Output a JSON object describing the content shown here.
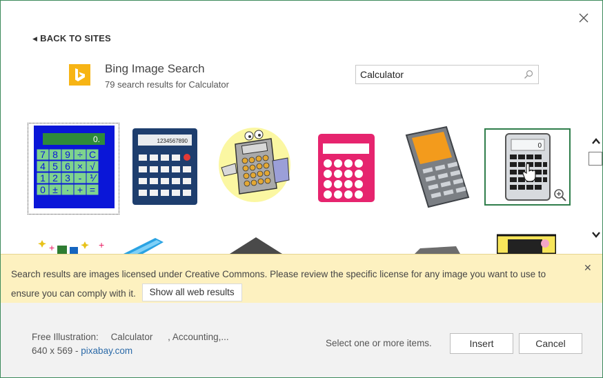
{
  "dialog": {
    "close_label": "Close",
    "back_link": "BACK TO SITES",
    "source": {
      "name": "Bing Image Search",
      "results": "79 search results for Calculator"
    },
    "search": {
      "value": "Calculator",
      "placeholder": ""
    },
    "thumbnails": [
      {
        "name": "calculator-blue-green-keys",
        "state": "focused"
      },
      {
        "name": "calculator-navy-1234567890",
        "display_text": "1234567890"
      },
      {
        "name": "calculator-cartoon-character"
      },
      {
        "name": "calculator-pink"
      },
      {
        "name": "calculator-gray-orange-screen"
      },
      {
        "name": "calculator-gray-pointer",
        "state": "selected"
      }
    ],
    "notice": {
      "text": "Search results are images licensed under Creative Commons. Please review the specific license for any image you want to use to ensure you can comply with it.",
      "button": "Show all web results",
      "close": "✕"
    },
    "footer": {
      "caption_label": "Free Illustration:",
      "caption_term": "Calculator",
      "caption_more": ", Accounting,...",
      "dimensions": "640 x 569 - ",
      "site": "pixabay.com",
      "hint": "Select one or more items.",
      "insert": "Insert",
      "cancel": "Cancel"
    }
  },
  "colors": {
    "accent_green": "#2e7d4a",
    "notice_bg": "#fdf1c0",
    "footer_bg": "#f2f2f2",
    "bing_yellow": "#f7b414",
    "link_blue": "#2b6aa8"
  }
}
